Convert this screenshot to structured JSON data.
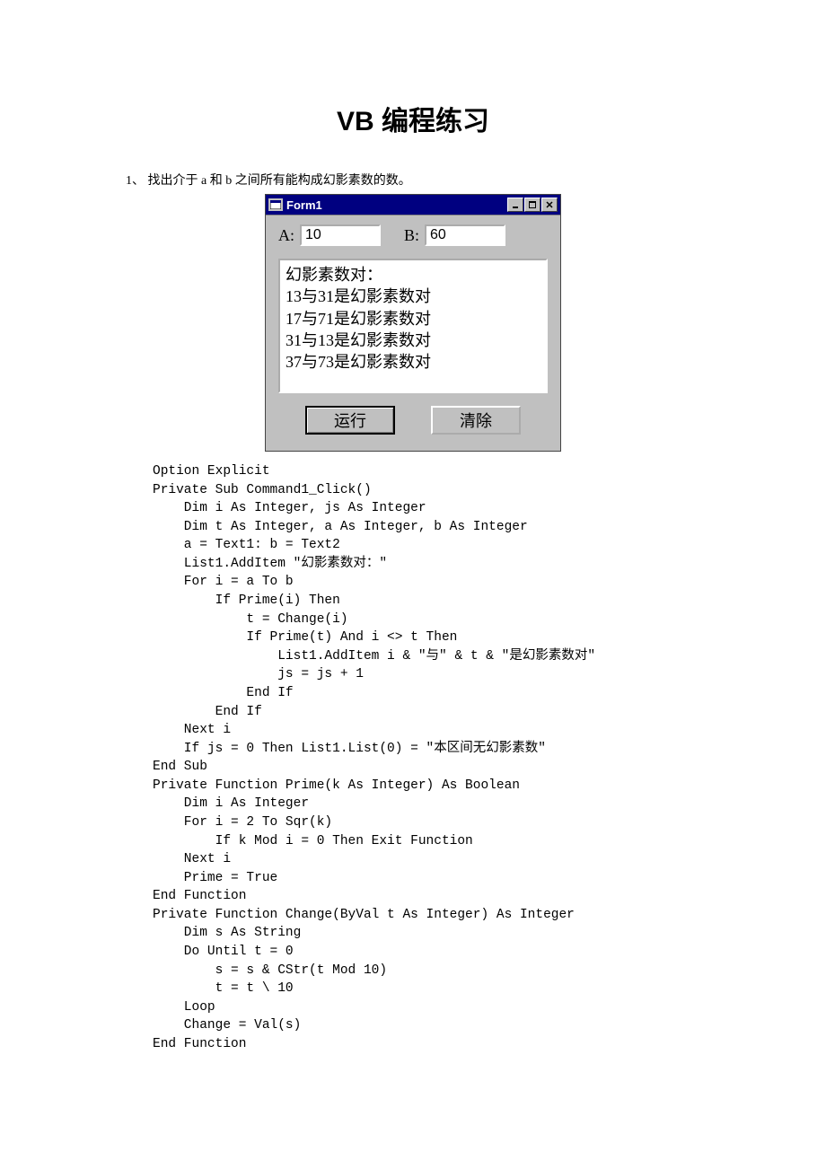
{
  "title": {
    "en": "VB",
    "zh": "编程练习"
  },
  "problem": "1、 找出介于 a 和 b 之间所有能构成幻影素数的数。",
  "form": {
    "caption": "Form1",
    "labelA": "A:",
    "valueA": "10",
    "labelB": "B:",
    "valueB": "60",
    "listItems": [
      "幻影素数对：",
      "13与31是幻影素数对",
      "17与71是幻影素数对",
      "31与13是幻影素数对",
      "37与73是幻影素数对"
    ],
    "runBtn": "运行",
    "clearBtn": "清除"
  },
  "code": "Option Explicit\nPrivate Sub Command1_Click()\n    Dim i As Integer, js As Integer\n    Dim t As Integer, a As Integer, b As Integer\n    a = Text1: b = Text2\n    List1.AddItem \"幻影素数对：\"\n    For i = a To b\n        If Prime(i) Then\n            t = Change(i)\n            If Prime(t) And i <> t Then\n                List1.AddItem i & \"与\" & t & \"是幻影素数对\"\n                js = js + 1\n            End If\n        End If\n    Next i\n    If js = 0 Then List1.List(0) = \"本区间无幻影素数\"\nEnd Sub\nPrivate Function Prime(k As Integer) As Boolean\n    Dim i As Integer\n    For i = 2 To Sqr(k)\n        If k Mod i = 0 Then Exit Function\n    Next i\n    Prime = True\nEnd Function\nPrivate Function Change(ByVal t As Integer) As Integer\n    Dim s As String\n    Do Until t = 0\n        s = s & CStr(t Mod 10)\n        t = t \\ 10\n    Loop\n    Change = Val(s)\nEnd Function"
}
